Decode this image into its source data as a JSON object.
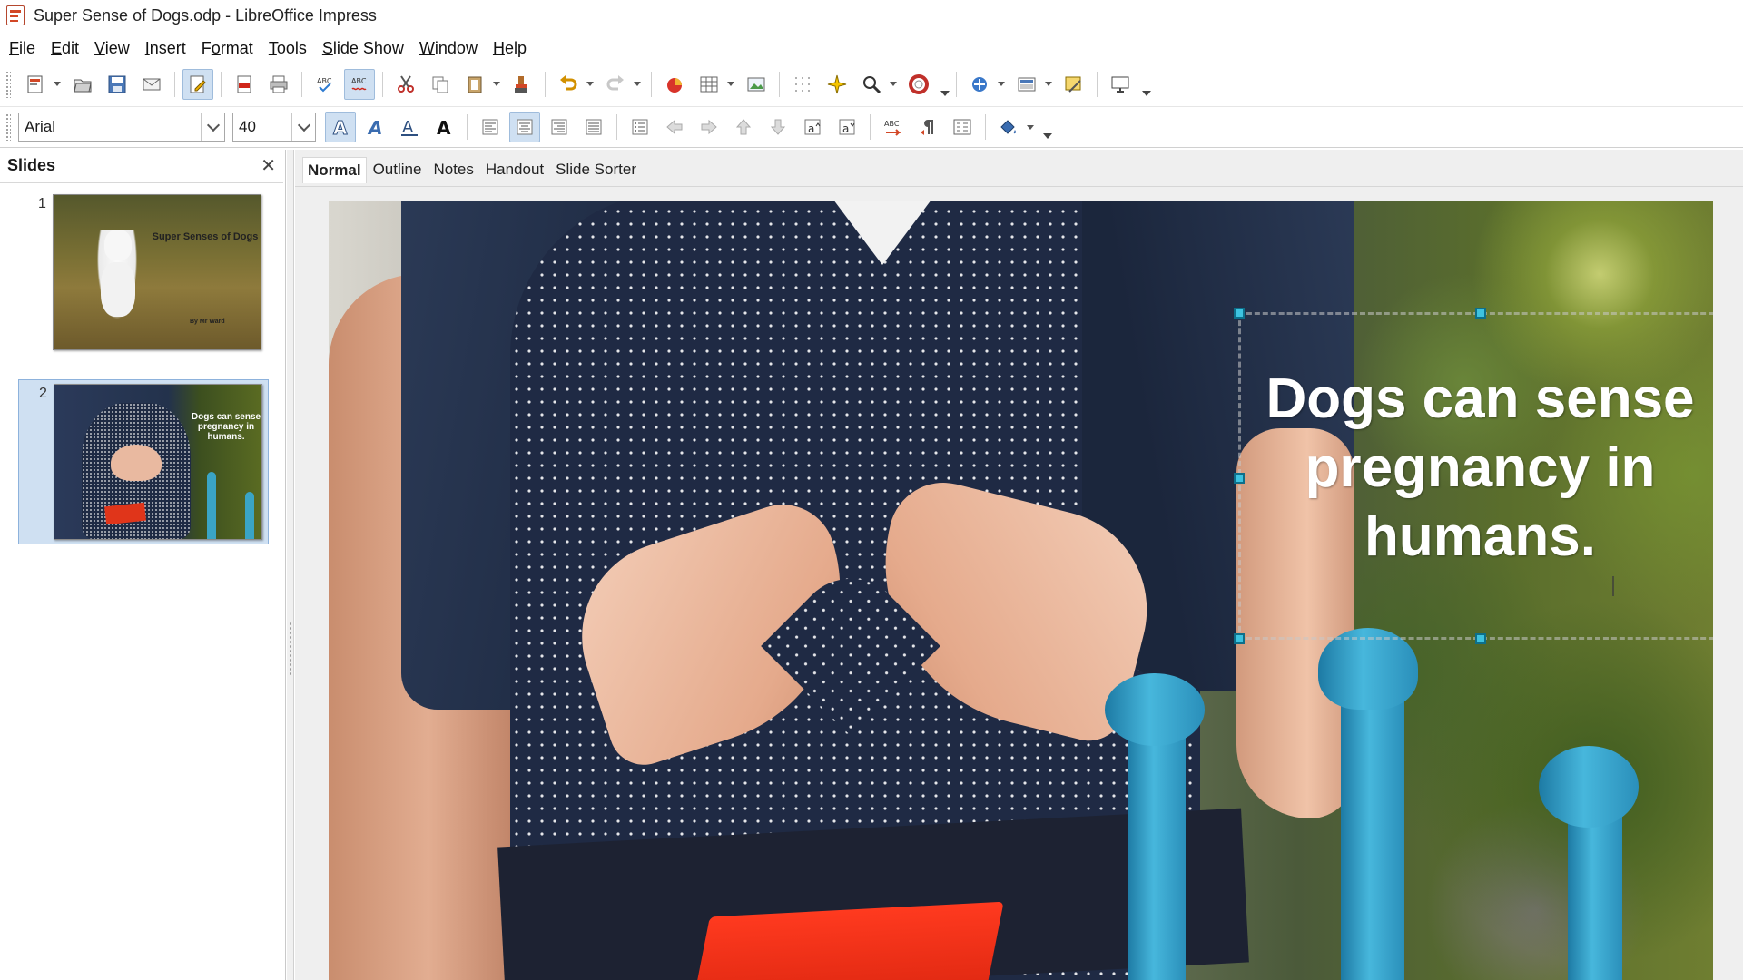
{
  "window": {
    "title": "Super Sense of Dogs.odp - LibreOffice Impress"
  },
  "menubar": {
    "items": [
      {
        "label_pre": "",
        "label_ul": "F",
        "label_post": "ile"
      },
      {
        "label_pre": "",
        "label_ul": "E",
        "label_post": "dit"
      },
      {
        "label_pre": "",
        "label_ul": "V",
        "label_post": "iew"
      },
      {
        "label_pre": "",
        "label_ul": "I",
        "label_post": "nsert"
      },
      {
        "label_pre": "F",
        "label_ul": "o",
        "label_post": "rmat"
      },
      {
        "label_pre": "",
        "label_ul": "T",
        "label_post": "ools"
      },
      {
        "label_pre": "",
        "label_ul": "S",
        "label_post": "lide Show"
      },
      {
        "label_pre": "",
        "label_ul": "W",
        "label_post": "indow"
      },
      {
        "label_pre": "",
        "label_ul": "H",
        "label_post": "elp"
      }
    ]
  },
  "format_toolbar": {
    "font_name": "Arial",
    "font_size": "40"
  },
  "slides_pane": {
    "title": "Slides",
    "close_glyph": "✕",
    "slides": [
      {
        "number": "1",
        "title": "Super Senses of Dogs",
        "subtitle": "By Mr Ward"
      },
      {
        "number": "2",
        "text": "Dogs can sense pregnancy in humans."
      }
    ]
  },
  "view_tabs": [
    "Normal",
    "Outline",
    "Notes",
    "Handout",
    "Slide Sorter"
  ],
  "slide": {
    "text_line1": "Dogs can sense",
    "text_line2": "pregnancy in",
    "text_line3": "humans."
  }
}
